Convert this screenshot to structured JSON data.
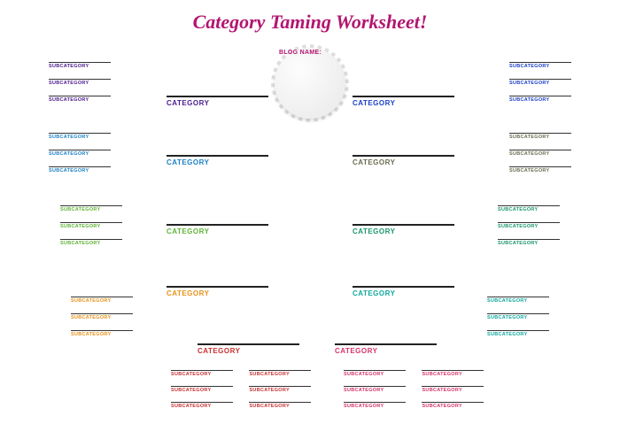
{
  "title": "Category Taming Worksheet!",
  "blog_label": "BLOG NAME:",
  "cat_label": "CATEGORY",
  "sub_label": "SUBCATEGORY",
  "colors": {
    "c1": "#4a1a8c",
    "c2": "#1a7fc4",
    "c3": "#5fb336",
    "c4": "#e8911a",
    "c5": "#c73030",
    "c6": "#1a3fc4",
    "c7": "#6b6b50",
    "c8": "#1a9668",
    "c9": "#0fa89e",
    "c10": "#d6336c"
  }
}
